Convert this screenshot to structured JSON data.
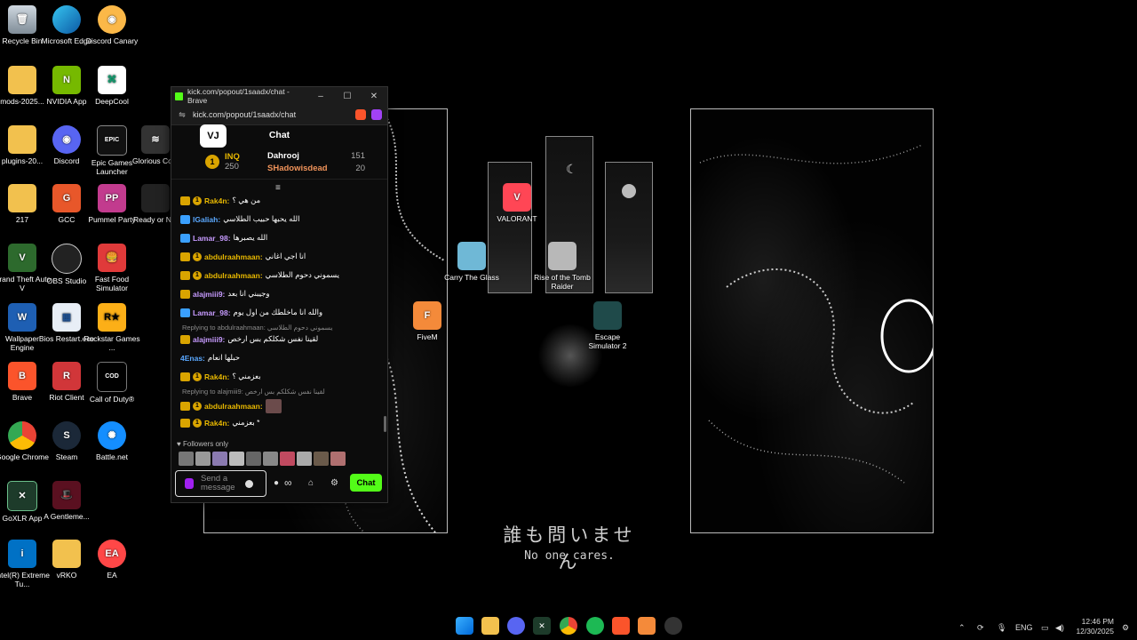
{
  "wallpaper": {
    "jp_text": "誰も問いません",
    "en_text": "No one cares."
  },
  "desktop_icons": {
    "col1": [
      "Recycle Bin",
      "mods-2025...",
      "plugins-20...",
      "217",
      "Grand Theft Auto V",
      "Wallpaper Engine",
      "Brave",
      "Google Chrome",
      "GoXLR App",
      "Intel(R) Extreme Tu..."
    ],
    "col2": [
      "Microsoft Edge",
      "NVIDIA App",
      "Discord",
      "GCC",
      "OBS Studio",
      "Bios Restart.exe",
      "Riot Client",
      "Steam",
      "A Gentleme...",
      "vRKO"
    ],
    "col3": [
      "Discord Canary",
      "DeepCool",
      "Epic Games Launcher",
      "Pummel Party",
      "Fast Food Simulator",
      "Rockstar Games ...",
      "Call of Duty®",
      "Battle.net",
      "EA"
    ],
    "col4": [
      "Glorious Co...",
      "Ready or N..."
    ],
    "extra": {
      "valorant": "VALORANT",
      "carry": "Carry The Glass",
      "rise": "Rise of the Tomb Raider",
      "fivem": "FiveM",
      "escape": "Escape Simulator 2"
    }
  },
  "browser": {
    "window_title": "kick.com/popout/1saadx/chat - Brave",
    "url": "kick.com/popout/1saadx/chat",
    "chat_title": "Chat",
    "leaders": {
      "rank": "1",
      "first_name": "INQ",
      "first_value": "250",
      "second_name": "Dahrooj",
      "second_value": "151",
      "third_name": "SHadowisdead",
      "third_value": "20"
    },
    "messages": [
      {
        "user": "Rak4n:",
        "text": "من هي ؟",
        "color": "#e8b800"
      },
      {
        "user": "lGaliah:",
        "text": "الله يحبها حبيب الطلاسي",
        "color": "#5aa8ff"
      },
      {
        "user": "Lamar_98:",
        "text": "الله يصبرها",
        "color": "#c79bff"
      },
      {
        "user": "abdulraahmaan:",
        "text": "انا اجي اغاني",
        "color": "#e8b800"
      },
      {
        "user": "abdulraahmaan:",
        "text": "يسموني دحوم الطلاسي",
        "color": "#e8b800"
      },
      {
        "user": "alajmiii9:",
        "text": "وجيبني انا بعد",
        "color": "#c79bff"
      },
      {
        "user": "Lamar_98:",
        "text": "والله انا ماخلطك من اول يوم",
        "color": "#c79bff"
      },
      {
        "user": "alajmiii9:",
        "text": "لقينا نفس شكلكم بس ارخص",
        "color": "#c79bff"
      },
      {
        "user": "4Enas:",
        "text": "حبلها انعام",
        "color": "#5aa8ff"
      },
      {
        "user": "Rak4n:",
        "text": "بعزمني ؟",
        "color": "#e8b800"
      },
      {
        "user": "abdulraahmaan:",
        "text": "",
        "color": "#e8b800"
      },
      {
        "user": "Rak4n:",
        "text": "بعزمني *",
        "color": "#e8b800"
      }
    ],
    "reply1": "Replying to abdulraahmaan: يسموني دحوم الطلاسي",
    "reply2": "Replying to alajmiii9: لقينا نفس شكلكم بس ارخص",
    "followers_label": "Followers only",
    "input_placeholder": "Send a message",
    "chat_button": "Chat",
    "infinity": "∞"
  },
  "taskbar": {
    "lang": "ENG",
    "time": "12:46 PM",
    "date": "12/30/2025"
  }
}
